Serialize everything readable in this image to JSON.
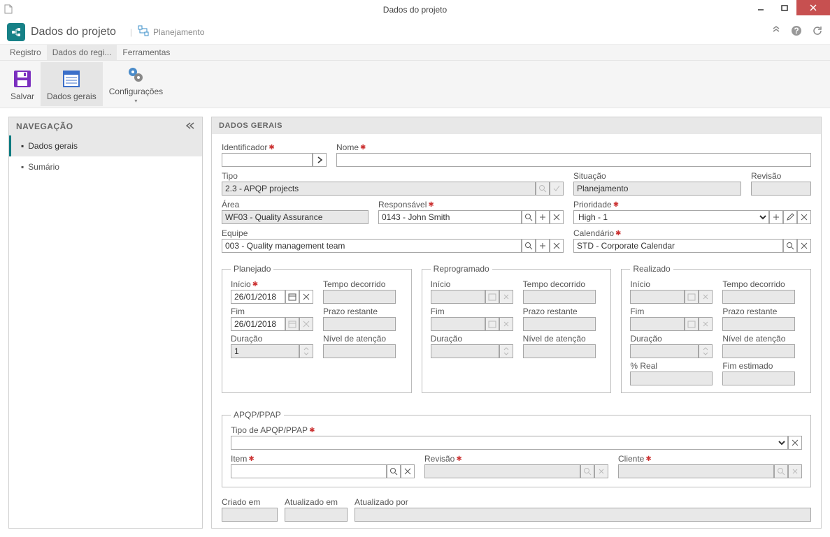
{
  "window": {
    "title": "Dados do projeto"
  },
  "header": {
    "app_title": "Dados do projeto",
    "breadcrumb_mode": "Planejamento"
  },
  "ribbon_tabs": {
    "t0": "Registro",
    "t1": "Dados do regi...",
    "t2": "Ferramentas"
  },
  "ribbon": {
    "save": "Salvar",
    "general": "Dados gerais",
    "config": "Configurações"
  },
  "sidebar": {
    "header": "NAVEGAÇÃO",
    "items": [
      {
        "label": "Dados gerais"
      },
      {
        "label": "Sumário"
      }
    ]
  },
  "content": {
    "header": "DADOS GERAIS"
  },
  "form": {
    "id_label": "Identificador",
    "id_value": "",
    "name_label": "Nome",
    "name_value": "",
    "type_label": "Tipo",
    "type_value": "2.3 - APQP projects",
    "situation_label": "Situação",
    "situation_value": "Planejamento",
    "revision_label": "Revisão",
    "revision_value": "",
    "area_label": "Área",
    "area_value": "WF03 - Quality Assurance",
    "responsible_label": "Responsável",
    "responsible_value": "0143 - John Smith",
    "priority_label": "Prioridade",
    "priority_value": "High - 1",
    "team_label": "Equipe",
    "team_value": "003 - Quality management team",
    "calendar_label": "Calendário",
    "calendar_value": "STD - Corporate Calendar"
  },
  "planned": {
    "legend": "Planejado",
    "start_label": "Início",
    "start_value": "26/01/2018",
    "elapsed_label": "Tempo decorrido",
    "elapsed_value": "",
    "end_label": "Fim",
    "end_value": "26/01/2018",
    "remaining_label": "Prazo restante",
    "remaining_value": "",
    "duration_label": "Duração",
    "duration_value": "1",
    "attention_label": "Nível de atenção",
    "attention_value": ""
  },
  "rescheduled": {
    "legend": "Reprogramado",
    "start_label": "Início",
    "elapsed_label": "Tempo decorrido",
    "end_label": "Fim",
    "remaining_label": "Prazo restante",
    "duration_label": "Duração",
    "attention_label": "Nível de atenção"
  },
  "done": {
    "legend": "Realizado",
    "start_label": "Início",
    "elapsed_label": "Tempo decorrido",
    "end_label": "Fim",
    "remaining_label": "Prazo restante",
    "duration_label": "Duração",
    "attention_label": "Nível de atenção",
    "pct_label": "% Real",
    "est_end_label": "Fim estimado"
  },
  "apqp": {
    "legend": "APQP/PPAP",
    "type_label": "Tipo de APQP/PPAP",
    "type_value": "",
    "item_label": "Item",
    "item_value": "",
    "rev_label": "Revisão",
    "rev_value": "",
    "client_label": "Cliente",
    "client_value": ""
  },
  "audit": {
    "created_label": "Criado em",
    "updated_label": "Atualizado em",
    "updated_by_label": "Atualizado por"
  }
}
